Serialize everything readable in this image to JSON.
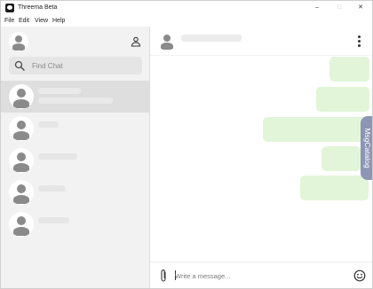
{
  "window": {
    "title": "Threema Beta",
    "controls": {
      "minimize": "–",
      "maximize": "□",
      "close": "✕"
    }
  },
  "menu": {
    "items": [
      "File",
      "Edit",
      "View",
      "Help"
    ]
  },
  "sidebar": {
    "search": {
      "placeholder": "Find Chat",
      "value": ""
    },
    "selected_index": 0
  },
  "composer": {
    "placeholder": "Write a message...",
    "value": ""
  },
  "side_tab": {
    "label": "MsgCatalog"
  },
  "colors": {
    "sidebar_bg": "#f2f2f2",
    "selected_chat": "#dedede",
    "bubble": "#e2f5d9",
    "side_tab": "#8c95b3",
    "avatar_silhouette": "#8a8a8a"
  }
}
